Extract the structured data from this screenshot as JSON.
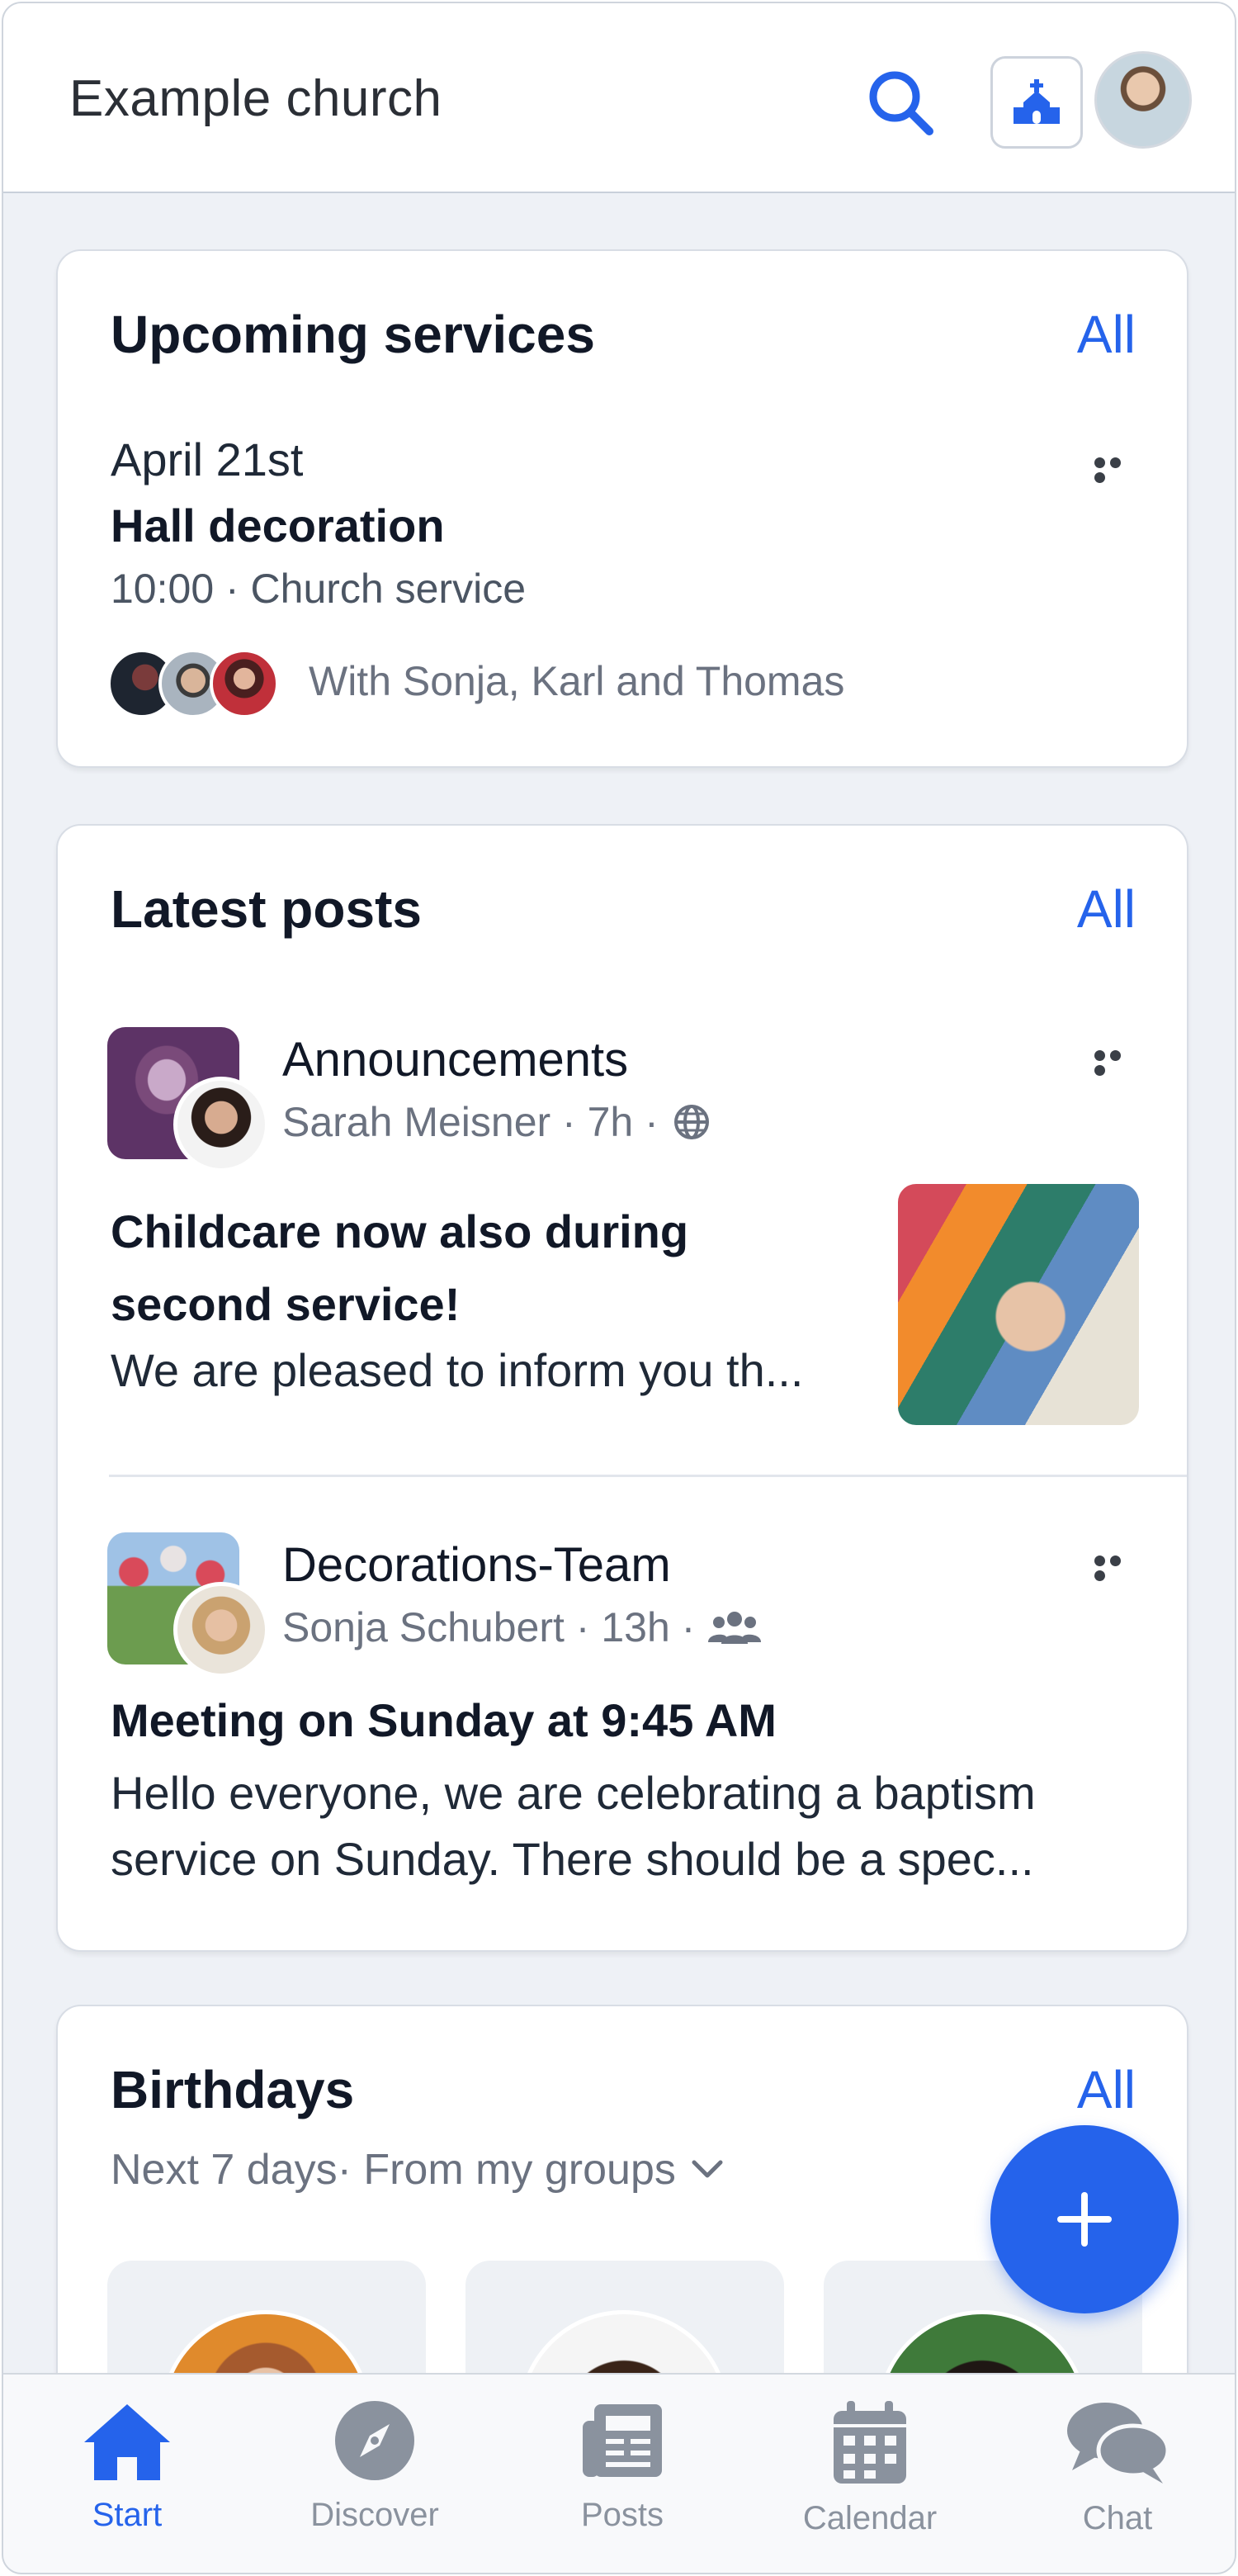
{
  "header": {
    "title": "Example church",
    "search_icon": "search-icon",
    "church_icon": "church-icon"
  },
  "services": {
    "title": "Upcoming services",
    "all_label": "All",
    "item": {
      "date": "April 21st",
      "name": "Hall decoration",
      "meta": "10:00 · Church service",
      "with_text": "With Sonja, Karl and Thomas"
    }
  },
  "posts": {
    "title": "Latest posts",
    "all_label": "All",
    "items": [
      {
        "group": "Announcements",
        "author_meta": "Sarah Meisner · 7h ·",
        "visibility_icon": "globe-icon",
        "title_line1": "Childcare now also during",
        "title_line2": "second service!",
        "body_line1": "We are pleased to inform you th..."
      },
      {
        "group": "Decorations-Team",
        "author_meta": "Sonja Schubert · 13h ·",
        "visibility_icon": "group-icon",
        "title_line1": "Meeting on Sunday at 9:45 AM",
        "body_line1": "Hello everyone, we are celebrating a baptism",
        "body_line2": "service on Sunday. There should be a spec..."
      }
    ]
  },
  "birthdays": {
    "title": "Birthdays",
    "all_label": "All",
    "filter": "Next 7 days· From my groups"
  },
  "nav": {
    "items": [
      {
        "label": "Start",
        "icon": "home-icon",
        "active": true
      },
      {
        "label": "Discover",
        "icon": "compass-icon",
        "active": false
      },
      {
        "label": "Posts",
        "icon": "newspaper-icon",
        "active": false
      },
      {
        "label": "Calendar",
        "icon": "calendar-icon",
        "active": false
      },
      {
        "label": "Chat",
        "icon": "chat-icon",
        "active": false
      }
    ]
  },
  "colors": {
    "accent": "#2563eb",
    "background": "#eef1f6",
    "card": "#ffffff"
  }
}
